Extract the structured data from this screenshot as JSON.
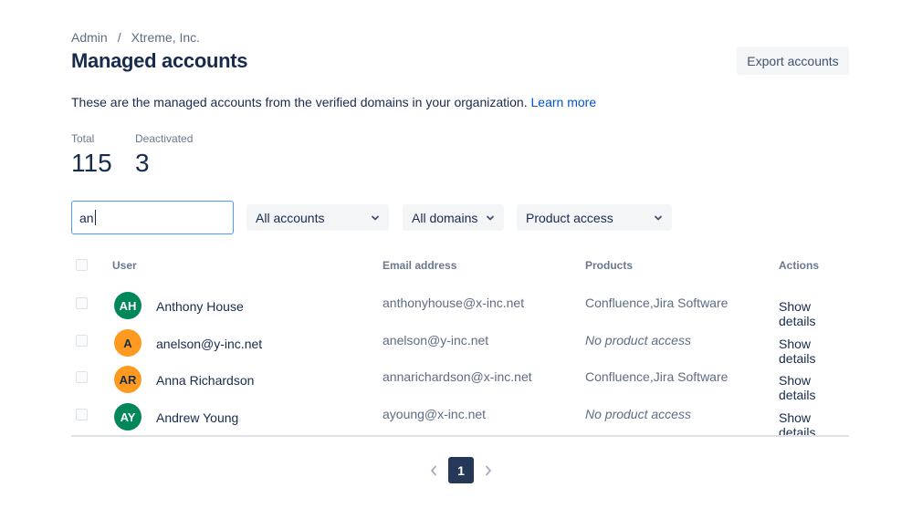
{
  "breadcrumb": {
    "items": [
      "Admin",
      "Xtreme, Inc."
    ],
    "separator": "/"
  },
  "page_title": "Managed accounts",
  "export_label": "Export accounts",
  "intro": {
    "text": "These are the managed accounts from the verified domains in your organization.",
    "link": "Learn more"
  },
  "stats": {
    "total_label": "Total",
    "total_value": "115",
    "deactivated_label": "Deactivated",
    "deactivated_value": "3"
  },
  "search": {
    "value": "an"
  },
  "filters": {
    "accounts": "All accounts",
    "domains": "All domains",
    "products": "Product access"
  },
  "table": {
    "headers": {
      "user": "User",
      "email": "Email address",
      "products": "Products",
      "actions": "Actions"
    },
    "rows": [
      {
        "initials": "AH",
        "avatar_color": "#00875a",
        "name": "Anthony House",
        "email": "anthonyhouse@x-inc.net",
        "products": "Confluence,Jira Software",
        "action": "Show details"
      },
      {
        "initials": "A",
        "avatar_color": "#ff991f",
        "name": "anelson@y-inc.net",
        "email": "anelson@y-inc.net",
        "products": "No product access",
        "action": "Show details"
      },
      {
        "initials": "AR",
        "avatar_color": "#ff991f",
        "name": "Anna Richardson",
        "email": "annarichardson@x-inc.net",
        "products": "Confluence,Jira Software",
        "action": "Show details"
      },
      {
        "initials": "AY",
        "avatar_color": "#00875a",
        "name": "Andrew Young",
        "email": "ayoung@x-inc.net",
        "products": "No product access",
        "action": "Show details"
      }
    ]
  },
  "pagination": {
    "current_page": "1"
  },
  "colors": {
    "link": "#0052cc",
    "primary_text": "#172b4d",
    "pager_active": "#253858",
    "focus_border": "#4c9aff"
  },
  "icons": {
    "dropdown": "chevron-down-icon",
    "prev": "chevron-left-icon",
    "next": "chevron-right-icon"
  }
}
